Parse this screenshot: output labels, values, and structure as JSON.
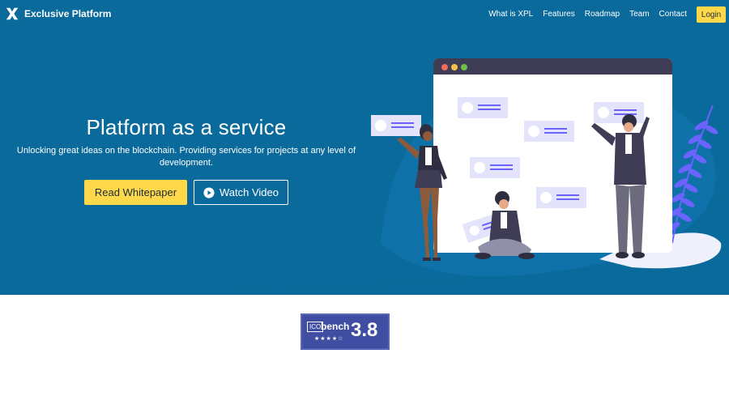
{
  "brand": {
    "name": "Exclusive Platform",
    "logo_icon": "x-logo-icon"
  },
  "nav": {
    "links": [
      "What is XPL",
      "Features",
      "Roadmap",
      "Team",
      "Contact"
    ],
    "login_label": "Login"
  },
  "hero": {
    "title": "Platform as a service",
    "subtitle": "Unlocking great ideas on the blockchain. Providing services for projects at any level of development.",
    "primary_cta": "Read Whitepaper",
    "secondary_cta": "Watch Video",
    "secondary_cta_icon": "play-circle-icon"
  },
  "badge": {
    "ico": "ICO",
    "bench": "bench",
    "stars": "★★★★☆",
    "score": "3.8"
  },
  "colors": {
    "hero_bg": "#0a6a9b",
    "accent_yellow": "#ffd94a",
    "badge_bg": "#3f4ea3",
    "illustration_purple": "#6c63ff"
  }
}
